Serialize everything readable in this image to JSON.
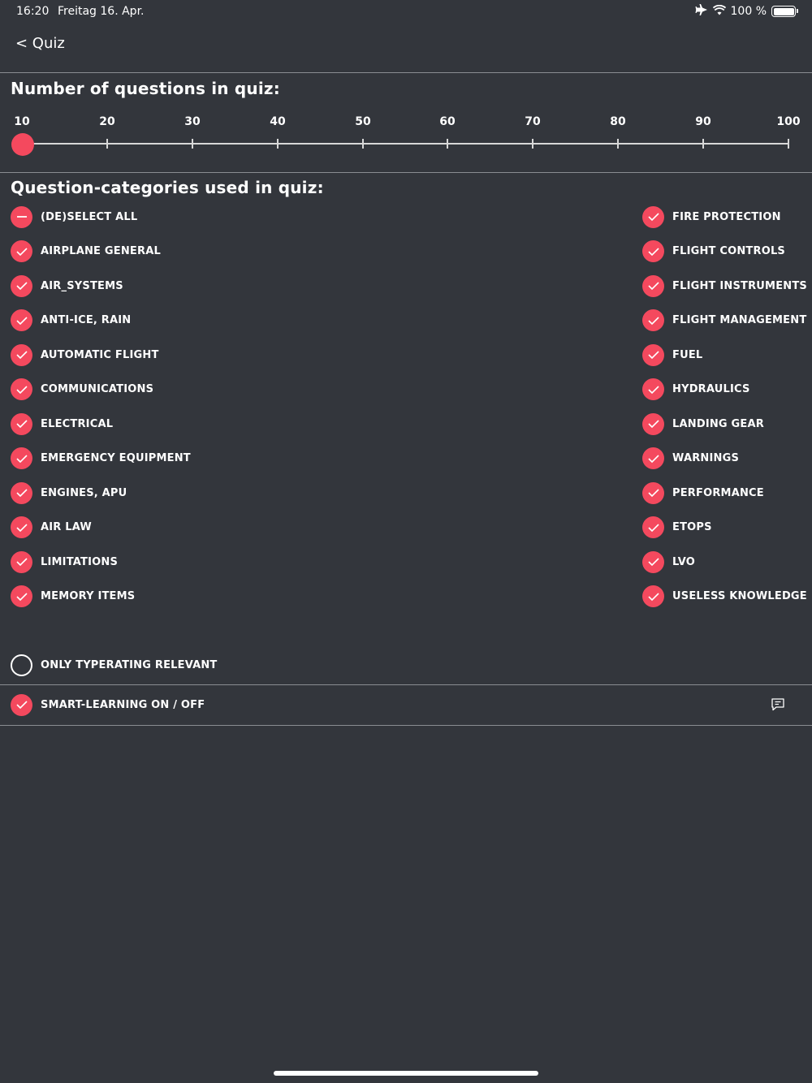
{
  "status_bar": {
    "time": "16:20",
    "date": "Freitag 16. Apr.",
    "battery_text": "100 %"
  },
  "nav": {
    "back_label": "< Quiz"
  },
  "question_count": {
    "title": "Number of questions in quiz:",
    "ticks": [
      "10",
      "20",
      "30",
      "40",
      "50",
      "60",
      "70",
      "80",
      "90",
      "100"
    ],
    "selected_value": 10,
    "accent_color": "#f4495e"
  },
  "categories": {
    "title": "Question-categories used in quiz:",
    "left": [
      {
        "label": "(DE)SELECT ALL",
        "state": "minus"
      },
      {
        "label": "AIRPLANE GENERAL",
        "state": "checked"
      },
      {
        "label": "AIR_SYSTEMS",
        "state": "checked"
      },
      {
        "label": "ANTI-ICE, RAIN",
        "state": "checked"
      },
      {
        "label": "AUTOMATIC FLIGHT",
        "state": "checked"
      },
      {
        "label": "COMMUNICATIONS",
        "state": "checked"
      },
      {
        "label": "ELECTRICAL",
        "state": "checked"
      },
      {
        "label": "EMERGENCY EQUIPMENT",
        "state": "checked"
      },
      {
        "label": "ENGINES, APU",
        "state": "checked"
      },
      {
        "label": "AIR LAW",
        "state": "checked"
      },
      {
        "label": "LIMITATIONS",
        "state": "checked"
      },
      {
        "label": "MEMORY ITEMS",
        "state": "checked"
      }
    ],
    "right": [
      {
        "label": "FIRE PROTECTION",
        "state": "checked"
      },
      {
        "label": "FLIGHT CONTROLS",
        "state": "checked"
      },
      {
        "label": "FLIGHT INSTRUMENTS",
        "state": "checked"
      },
      {
        "label": "FLIGHT MANAGEMENT",
        "state": "checked"
      },
      {
        "label": "FUEL",
        "state": "checked"
      },
      {
        "label": "HYDRAULICS",
        "state": "checked"
      },
      {
        "label": "LANDING GEAR",
        "state": "checked"
      },
      {
        "label": "WARNINGS",
        "state": "checked"
      },
      {
        "label": "PERFORMANCE",
        "state": "checked"
      },
      {
        "label": "ETOPS",
        "state": "checked"
      },
      {
        "label": "LVO",
        "state": "checked"
      },
      {
        "label": "USELESS KNOWLEDGE",
        "state": "checked"
      }
    ]
  },
  "options": {
    "typerating": {
      "label": "ONLY TYPERATING RELEVANT",
      "state": "unchecked"
    },
    "smart_learning": {
      "label": "SMART-LEARNING ON / OFF",
      "state": "checked",
      "icon": "chat-icon"
    }
  }
}
